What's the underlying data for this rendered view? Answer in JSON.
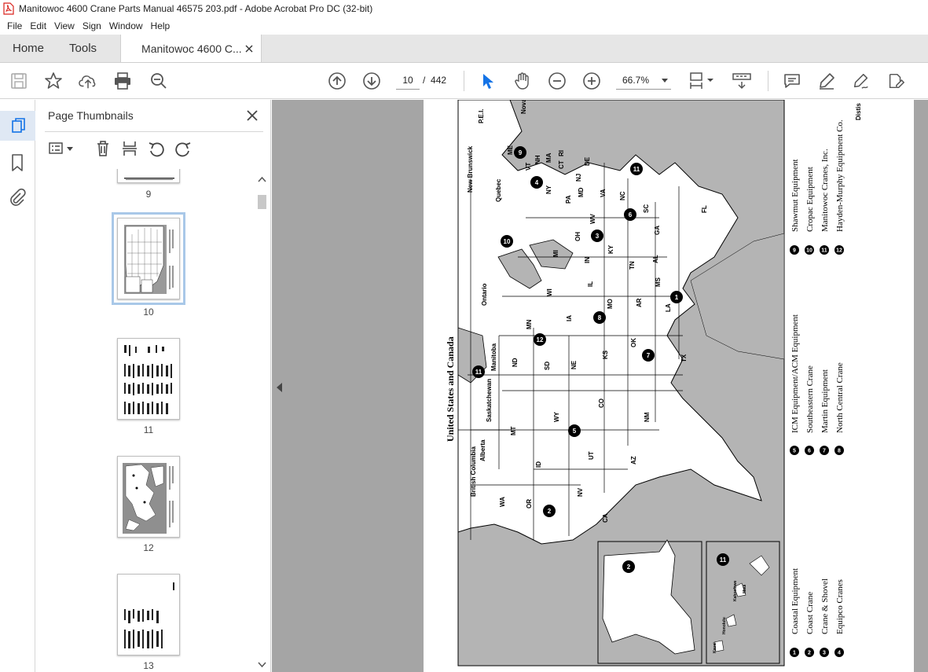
{
  "window": {
    "title": "Manitowoc 4600 Crane Parts Manual 46575 203.pdf - Adobe Acrobat Pro DC (32-bit)"
  },
  "menu": [
    "File",
    "Edit",
    "View",
    "Sign",
    "Window",
    "Help"
  ],
  "tabs": {
    "home": "Home",
    "tools": "Tools",
    "document": "Manitowoc 4600 C..."
  },
  "toolbar": {
    "current_page": "10",
    "page_separator": "/",
    "total_pages": "442",
    "zoom": "66.7%"
  },
  "thumbnails": {
    "title": "Page Thumbnails",
    "pages": [
      {
        "label": "9"
      },
      {
        "label": "10",
        "selected": true
      },
      {
        "label": "11"
      },
      {
        "label": "12"
      },
      {
        "label": "13"
      }
    ]
  },
  "document": {
    "map_title": "United States and Canada",
    "provinces": [
      "British Columbia",
      "Alberta",
      "Saskatchewan",
      "Manitoba",
      "Ontario",
      "Quebec",
      "New Brunswick",
      "P.E.I.",
      "Nova Scotia"
    ],
    "states": [
      "WA",
      "OR",
      "CA",
      "NV",
      "ID",
      "MT",
      "WY",
      "UT",
      "AZ",
      "CO",
      "NM",
      "ND",
      "SD",
      "NE",
      "KS",
      "OK",
      "TX",
      "MN",
      "IA",
      "MO",
      "AR",
      "LA",
      "WI",
      "IL",
      "MS",
      "MI",
      "IN",
      "KY",
      "TN",
      "AL",
      "OH",
      "WV",
      "GA",
      "FL",
      "SC",
      "NC",
      "VA",
      "PA",
      "NY",
      "MD",
      "DE",
      "NJ",
      "CT",
      "RI",
      "MA",
      "VT",
      "NH",
      "ME"
    ],
    "hawaii_labels": [
      "Kauai",
      "Honolulu",
      "Kahoolawe",
      "Maui"
    ],
    "legend": [
      {
        "num": "1",
        "name": "Coastal Equipment"
      },
      {
        "num": "2",
        "name": "Coast Crane"
      },
      {
        "num": "3",
        "name": "Crane & Shovel"
      },
      {
        "num": "4",
        "name": "Equipco Cranes"
      },
      {
        "num": "5",
        "name": "ICM Equipment/ACM Equipment"
      },
      {
        "num": "6",
        "name": "Southeastern Crane"
      },
      {
        "num": "7",
        "name": "Martin Equipment"
      },
      {
        "num": "8",
        "name": "North Central Crane"
      },
      {
        "num": "9",
        "name": "Shawmut Equipment"
      },
      {
        "num": "10",
        "name": "Cropac Equipment"
      },
      {
        "num": "11",
        "name": "Manitowoc Cranes, Inc."
      },
      {
        "num": "12",
        "name": "Hayden-Murphy Equipment Co."
      }
    ],
    "corner_text": "Distis"
  },
  "colors": {
    "accent": "#1473e6",
    "pdf_red": "#d9221c",
    "canvas": "#a5a5a5",
    "water": "#b4b4b4"
  }
}
